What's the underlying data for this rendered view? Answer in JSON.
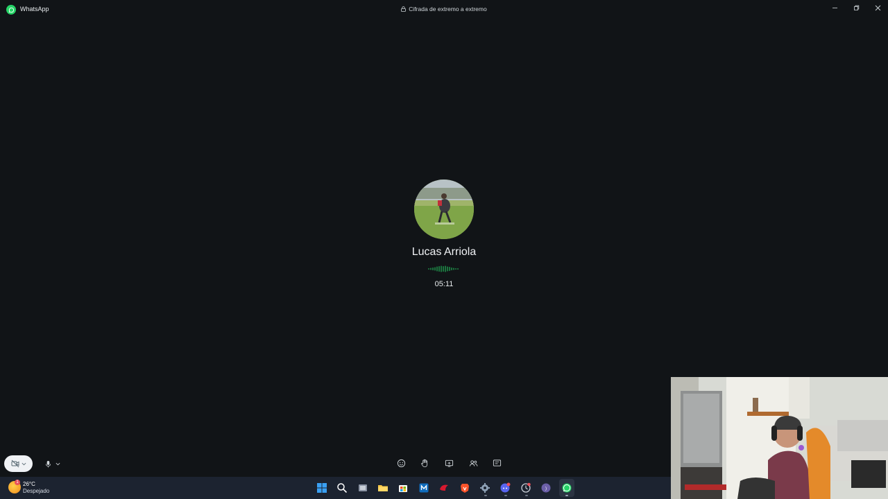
{
  "titlebar": {
    "app_name": "WhatsApp",
    "encryption_text": "Cifrada de extremo a extremo",
    "minimize_icon": "minimize-icon",
    "maximize_icon": "restore-icon",
    "close_icon": "close-icon"
  },
  "call": {
    "caller_name": "Lucas Arriola",
    "duration": "05:11",
    "status_indicator": "audio-waveform",
    "controls": [
      {
        "name": "camera-off-button",
        "icon": "camera-off-icon"
      },
      {
        "name": "microphone-button",
        "icon": "microphone-icon"
      },
      {
        "name": "reactions-button",
        "icon": "emoji-icon"
      },
      {
        "name": "raise-hand-button",
        "icon": "hand-icon"
      },
      {
        "name": "share-screen-button",
        "icon": "screen-share-icon"
      },
      {
        "name": "participants-button",
        "icon": "people-icon"
      },
      {
        "name": "chat-button",
        "icon": "chat-icon"
      }
    ]
  },
  "taskbar": {
    "weather_badge": "1",
    "temperature": "26°C",
    "weather_desc": "Despejado",
    "apps": [
      "start",
      "search",
      "task-view",
      "file-explorer",
      "store",
      "app",
      "app",
      "brave",
      "settings",
      "discord",
      "app",
      "app",
      "whatsapp"
    ]
  },
  "colors": {
    "background": "#111417",
    "accent": "#25d366",
    "taskbar": "#1c2330"
  }
}
